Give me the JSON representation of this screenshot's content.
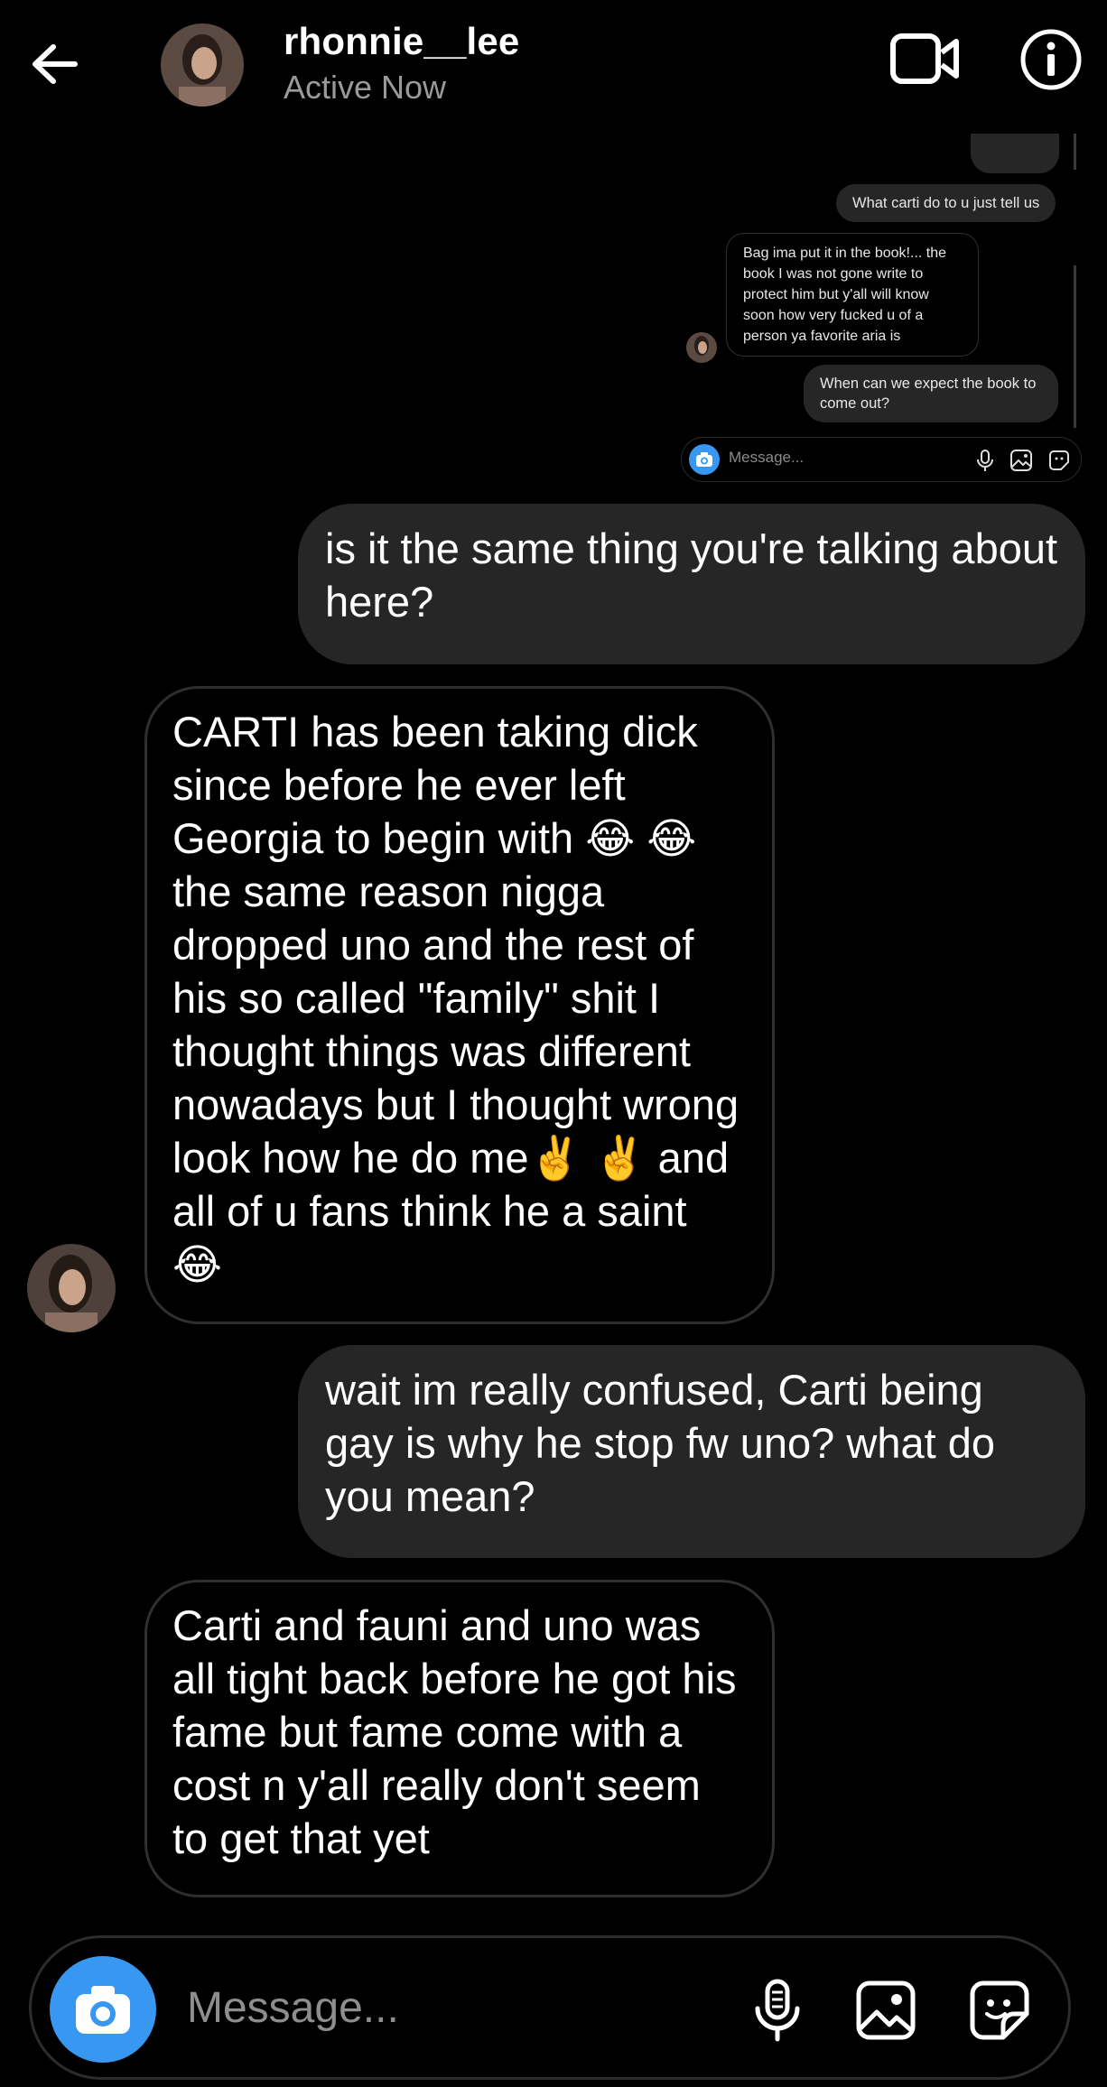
{
  "header": {
    "username": "rhonnie__lee",
    "status": "Active Now",
    "icons": [
      "back-arrow-icon",
      "video-call-icon",
      "info-icon"
    ]
  },
  "embedded_screenshot": {
    "messages": [
      {
        "direction": "sent",
        "text": "What carti do to u just tell us"
      },
      {
        "direction": "received",
        "text": "Bag ima put it in the book!... the book I was not gone write to protect him but y'all will know soon how very fucked u of a person ya favorite aria is"
      },
      {
        "direction": "sent",
        "text": "When can we expect the book to come out?"
      }
    ],
    "composer_placeholder": "Message..."
  },
  "messages": [
    {
      "direction": "sent",
      "text": "is it the same thing you're talking about here?"
    },
    {
      "direction": "received",
      "text": "CARTI has been taking dick since before he ever left Georgia to begin with 😂 😂 the same reason nigga dropped uno and the rest of his so called \"family\" shit I thought things was different nowadays but I thought wrong look how he do me✌️ ✌️ and all of u fans think he a saint 😂"
    },
    {
      "direction": "sent",
      "text": "wait im really confused, Carti being gay is why he stop fw uno? what do you mean?"
    },
    {
      "direction": "received",
      "text": "Carti and fauni and uno was all tight back before he got his fame but fame come with a cost n y'all really don't seem to get that yet"
    }
  ],
  "composer": {
    "placeholder": "Message...",
    "accent": "#3897f0"
  }
}
